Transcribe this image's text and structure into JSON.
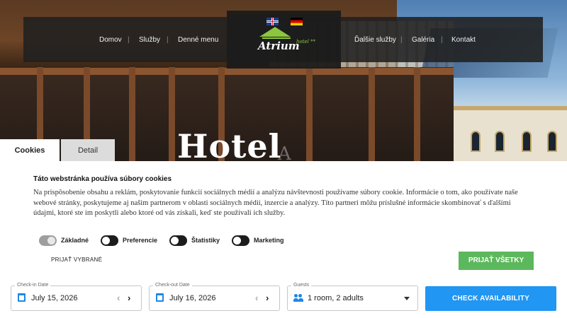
{
  "nav": {
    "left": [
      "Domov",
      "Služby",
      "Denné menu"
    ],
    "right": [
      "Ďalšie služby",
      "Galéria",
      "Kontakt"
    ],
    "languages": [
      "en",
      "de"
    ],
    "logo_text": "Atrium",
    "logo_subtext": "hotel **"
  },
  "hero": {
    "title": "Hotel",
    "title_faint": "A"
  },
  "cookie": {
    "tabs": {
      "cookies": "Cookies",
      "detail": "Detail"
    },
    "active_tab": "Cookies",
    "title": "Táto webstránka používa súbory cookies",
    "text": "Na prispôsobenie obsahu a reklám, poskytovanie funkcií sociálnych médií a analýzu návštevnosti používame súbory cookie. Informácie o tom, ako používate naše webové stránky, poskytujeme aj našim partnerom v oblasti sociálnych médií, inzercie a analýzy. Títo partneri môžu príslušné informácie skombinovať s ďalšími údajmi, ktoré ste im poskytli alebo ktoré od vás získali, keď ste používali ich služby.",
    "toggles": [
      {
        "label": "Základné",
        "state": "on",
        "disabled": true
      },
      {
        "label": "Preferencie",
        "state": "off",
        "disabled": false
      },
      {
        "label": "Štatistiky",
        "state": "off",
        "disabled": false
      },
      {
        "label": "Marketing",
        "state": "off",
        "disabled": false
      }
    ],
    "accept_selected": "PRIJAŤ VYBRANÉ",
    "accept_all": "PRIJAŤ VŠETKY",
    "accept_all_color": "#5cb85c"
  },
  "booking": {
    "checkin_label": "Check-in Date",
    "checkin_value": "July 15, 2026",
    "checkout_label": "Check-out Date",
    "checkout_value": "July 16, 2026",
    "guests_label": "Guests",
    "guests_value": "1 room, 2 adults",
    "submit": "CHECK AVAILABILITY",
    "accent": "#2196f3"
  }
}
